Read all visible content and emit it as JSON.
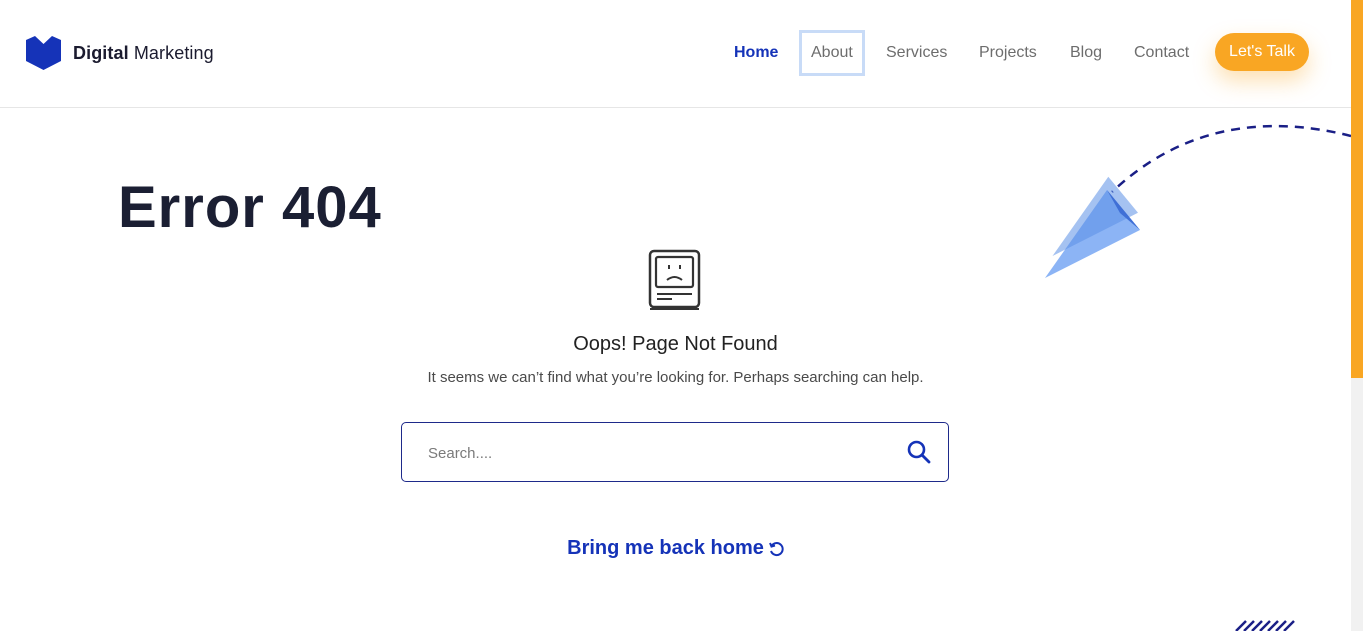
{
  "brand": {
    "name_bold": "Digital",
    "name_light": "Marketing",
    "color": "#1533b8"
  },
  "nav": {
    "items": [
      {
        "label": "Home",
        "state": "active"
      },
      {
        "label": "About",
        "state": "focused"
      },
      {
        "label": "Services",
        "state": "default"
      },
      {
        "label": "Projects",
        "state": "default"
      },
      {
        "label": "Blog",
        "state": "default"
      },
      {
        "label": "Contact",
        "state": "default"
      }
    ],
    "cta_label": "Let's Talk",
    "cta_color": "#f9a623"
  },
  "main": {
    "title": "Error 404",
    "heading": "Oops! Page Not Found",
    "description": "It seems we can’t find what you’re looking for. Perhaps searching can help.",
    "search": {
      "placeholder": "Search....",
      "value": ""
    },
    "home_link": "Bring me back home"
  },
  "icons": {
    "logo": "logo-icon",
    "sad_computer": "sad-computer-icon",
    "search": "search-icon",
    "refresh": "refresh-icon",
    "paper_plane": "paper-plane-icon"
  },
  "colors": {
    "accent": "#1533b8",
    "cta": "#f9a623",
    "title": "#1b1f33"
  }
}
